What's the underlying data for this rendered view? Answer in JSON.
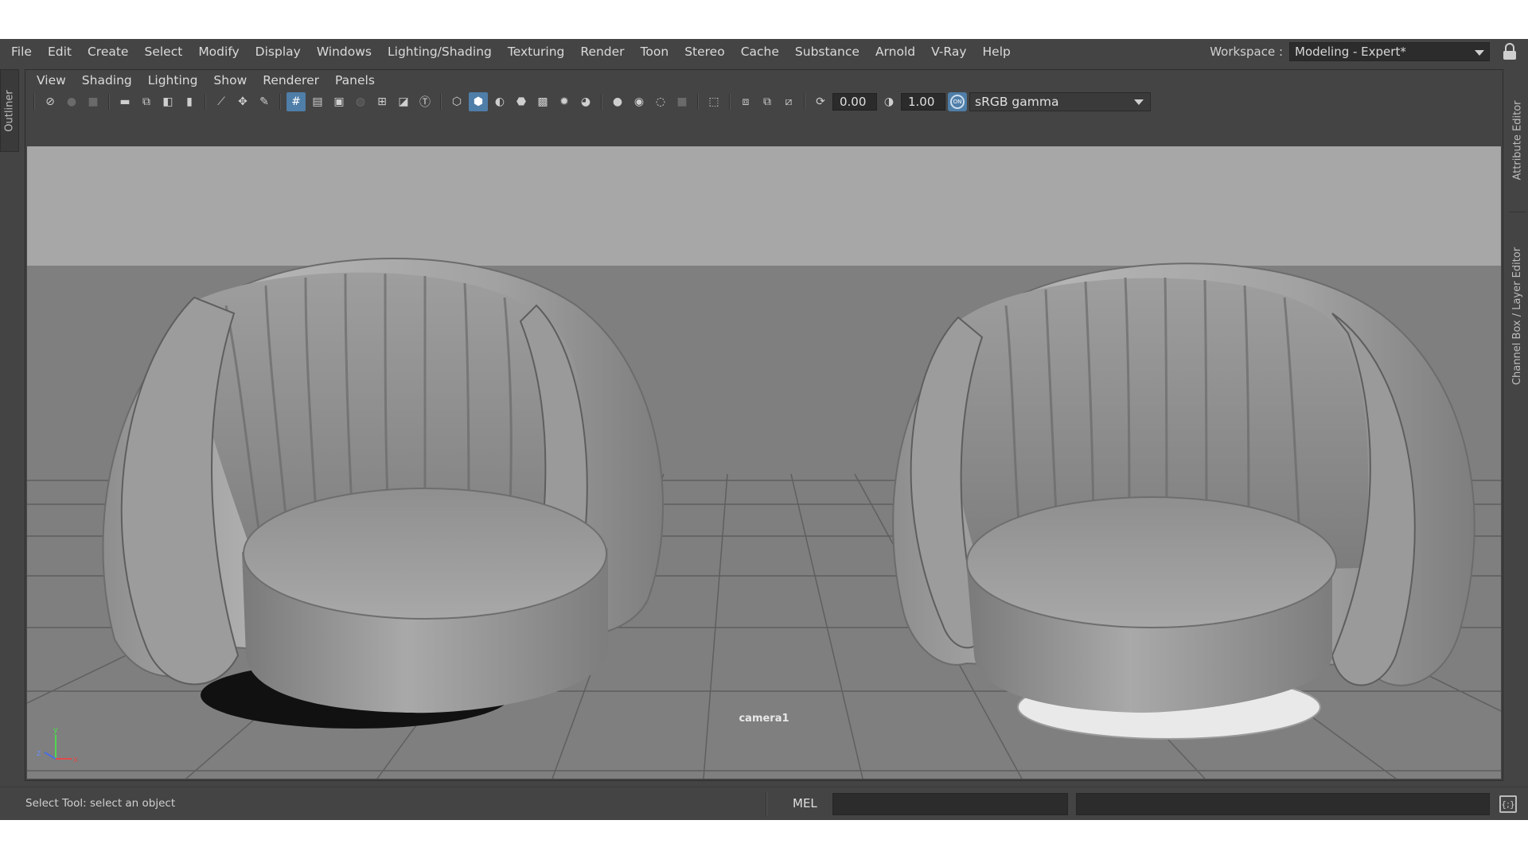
{
  "menubar": {
    "items": [
      "File",
      "Edit",
      "Create",
      "Select",
      "Modify",
      "Display",
      "Windows",
      "Lighting/Shading",
      "Texturing",
      "Render",
      "Toon",
      "Stereo",
      "Cache",
      "Substance",
      "Arnold",
      "V-Ray",
      "Help"
    ]
  },
  "workspace": {
    "label": "Workspace :",
    "value": "Modeling - Expert*"
  },
  "side_tabs": {
    "outliner": "Outliner",
    "attribute_editor": "Attribute Editor",
    "channel_box": "Channel Box / Layer Editor"
  },
  "panel": {
    "menu": [
      "View",
      "Shading",
      "Lighting",
      "Show",
      "Renderer",
      "Panels"
    ],
    "toolbar": {
      "exposure": "0.00",
      "gamma": "1.00",
      "color_space": "sRGB gamma",
      "on_badge": "ON"
    },
    "camera_label": "camera1",
    "axis": {
      "x": "x",
      "y": "y",
      "z": "z"
    }
  },
  "status": {
    "message": "Select Tool: select an object",
    "mel_label": "MEL"
  },
  "colors": {
    "ui_bg": "#444444",
    "viewport_bg": "#a7a7a7",
    "ground": "#7f7f7f",
    "accent": "#4f7ea8"
  }
}
